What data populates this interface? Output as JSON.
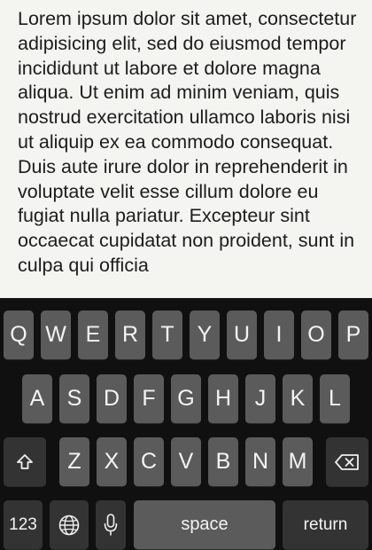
{
  "notes": {
    "body": "Lorem ipsum dolor sit amet, consectetur adipisicing elit, sed do eiusmod tempor incididunt ut labore et dolore magna aliqua. Ut enim ad minim veniam, quis nostrud exercitation ullamco laboris nisi ut aliquip ex ea commodo consequat. Duis aute irure dolor in reprehenderit in voluptate velit esse cillum dolore eu fugiat nulla pariatur. Excepteur sint occaecat cupidatat non proident, sunt in culpa qui officia"
  },
  "keyboard": {
    "row1": [
      "Q",
      "W",
      "E",
      "R",
      "T",
      "Y",
      "U",
      "I",
      "O",
      "P"
    ],
    "row2": [
      "A",
      "S",
      "D",
      "F",
      "G",
      "H",
      "J",
      "K",
      "L"
    ],
    "row3": [
      "Z",
      "X",
      "C",
      "V",
      "B",
      "N",
      "M"
    ],
    "numbers_label": "123",
    "space_label": "space",
    "return_label": "return",
    "icons": {
      "shift": "shift-icon",
      "delete": "delete-icon",
      "globe": "globe-icon",
      "mic": "microphone-icon"
    }
  }
}
